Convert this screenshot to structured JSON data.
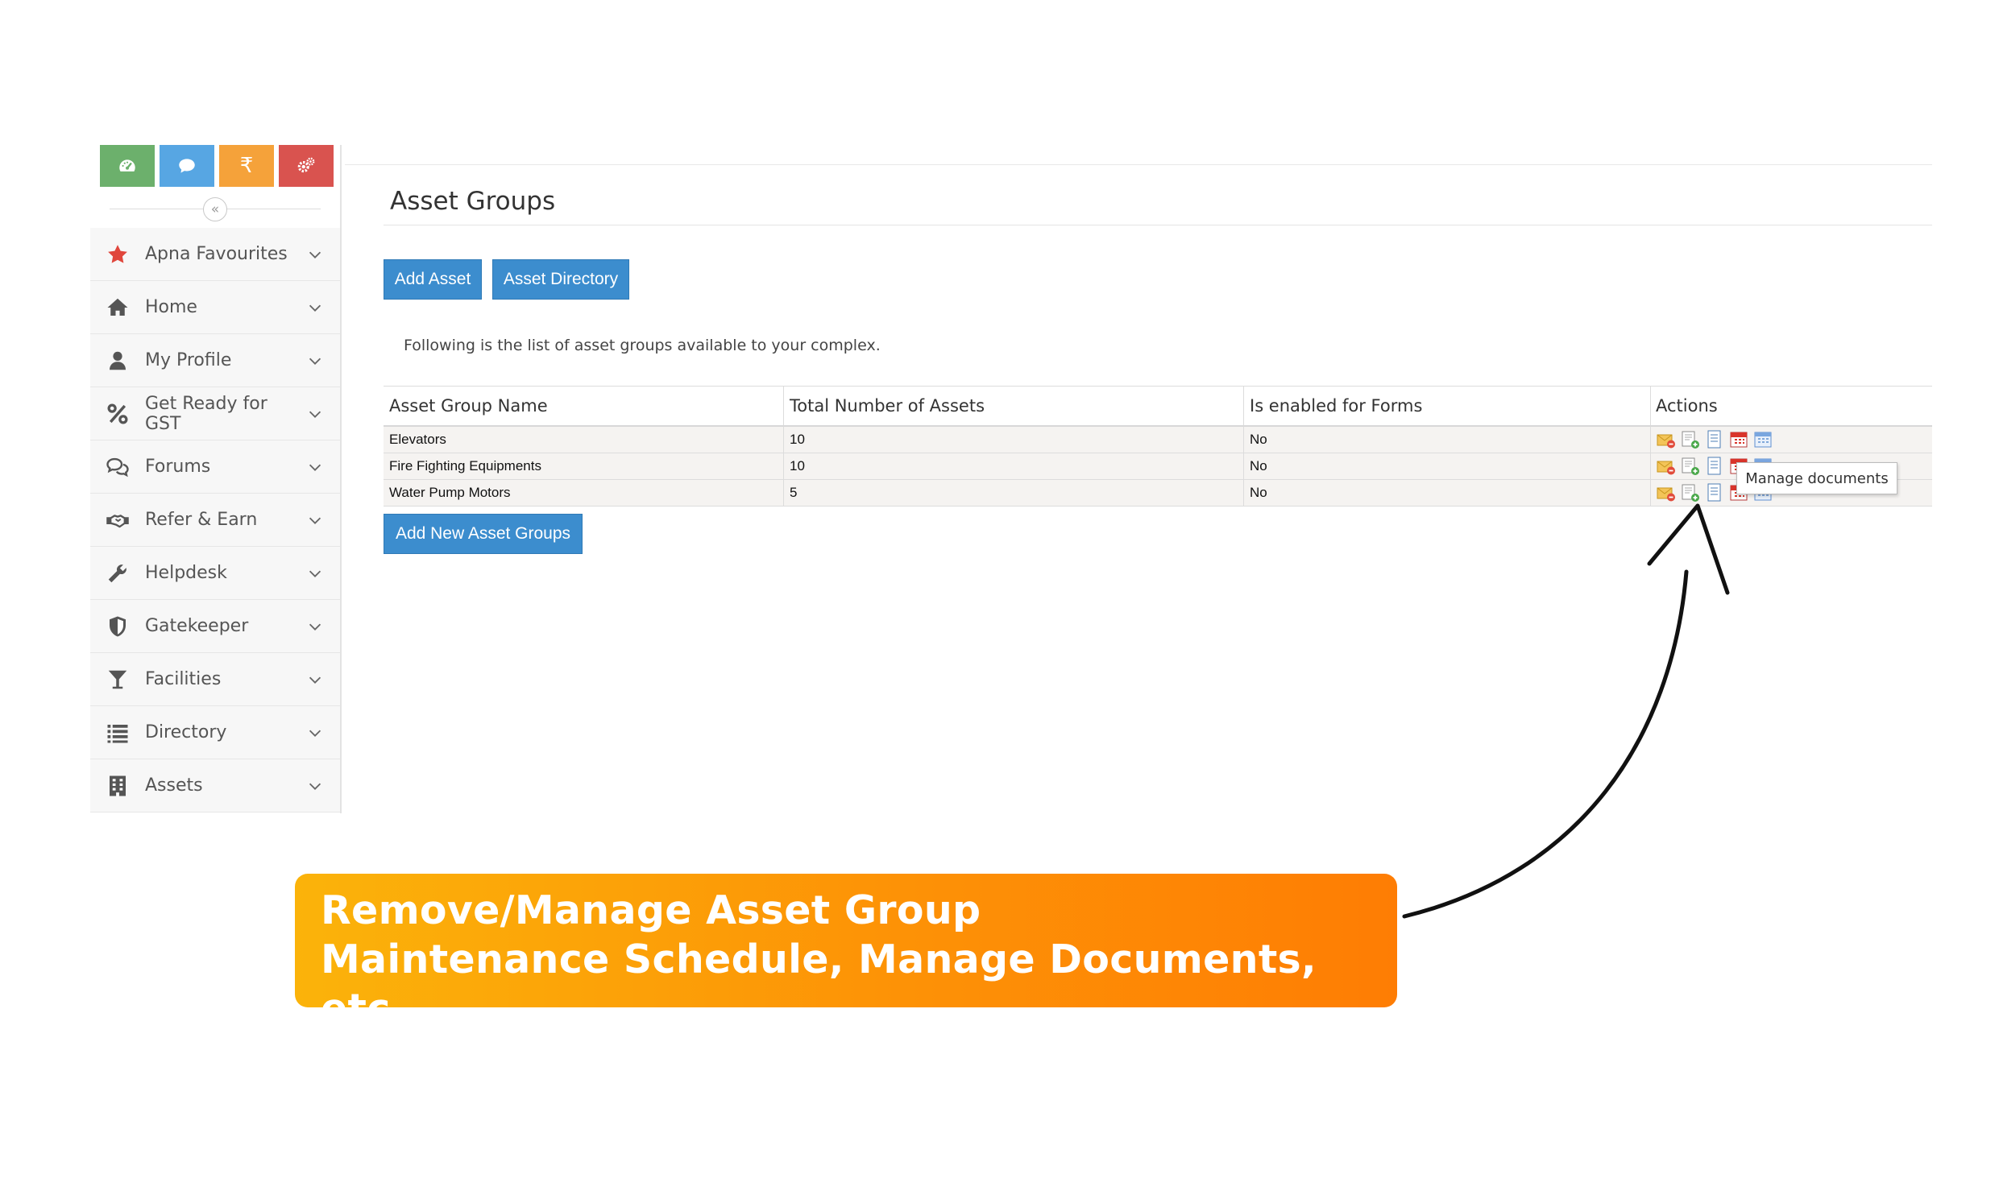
{
  "quick_icons": [
    {
      "name": "dashboard-icon",
      "color": "#6cb06c"
    },
    {
      "name": "chat-icon",
      "color": "#57a6e3"
    },
    {
      "name": "rupee-icon",
      "symbol": "₹",
      "color": "#f5a23a"
    },
    {
      "name": "settings-icon",
      "color": "#d9534f"
    }
  ],
  "sidebar": {
    "collapse_symbol": "«",
    "items": [
      {
        "label": "Apna Favourites",
        "icon": "star-icon"
      },
      {
        "label": "Home",
        "icon": "home-icon"
      },
      {
        "label": "My Profile",
        "icon": "user-icon"
      },
      {
        "label": "Get Ready for GST",
        "icon": "percent-icon"
      },
      {
        "label": "Forums",
        "icon": "forum-icon"
      },
      {
        "label": "Refer & Earn",
        "icon": "handshake-icon"
      },
      {
        "label": "Helpdesk",
        "icon": "wrench-icon"
      },
      {
        "label": "Gatekeeper",
        "icon": "shield-icon"
      },
      {
        "label": "Facilities",
        "icon": "glass-icon"
      },
      {
        "label": "Directory",
        "icon": "list-icon"
      },
      {
        "label": "Assets",
        "icon": "building-icon"
      }
    ]
  },
  "main": {
    "title": "Asset Groups",
    "buttons": {
      "add_asset": "Add Asset",
      "asset_directory": "Asset Directory",
      "add_new_groups": "Add New Asset Groups"
    },
    "intro": "Following is the list of asset groups available to your complex.",
    "table": {
      "headers": [
        "Asset Group Name",
        "Total Number of Assets",
        "Is enabled for Forms",
        "Actions"
      ],
      "rows": [
        {
          "name": "Elevators",
          "total": "10",
          "enabled": "No"
        },
        {
          "name": "Fire Fighting Equipments",
          "total": "10",
          "enabled": "No"
        },
        {
          "name": "Water Pump Motors",
          "total": "5",
          "enabled": "No"
        }
      ],
      "action_icons": [
        "remove-group-icon",
        "add-asset-icon",
        "manage-documents-icon",
        "maintenance-schedule-icon",
        "calendar-icon"
      ]
    },
    "tooltip": "Manage documents"
  },
  "callout": {
    "line1": "Remove/Manage Asset Group",
    "line2": "Maintenance Schedule, Manage Documents, etc.",
    "gradient": [
      "#fbb30a",
      "#fe7d04"
    ]
  },
  "colors": {
    "primary_button": "#3c8dce",
    "star": "#e0463c"
  }
}
